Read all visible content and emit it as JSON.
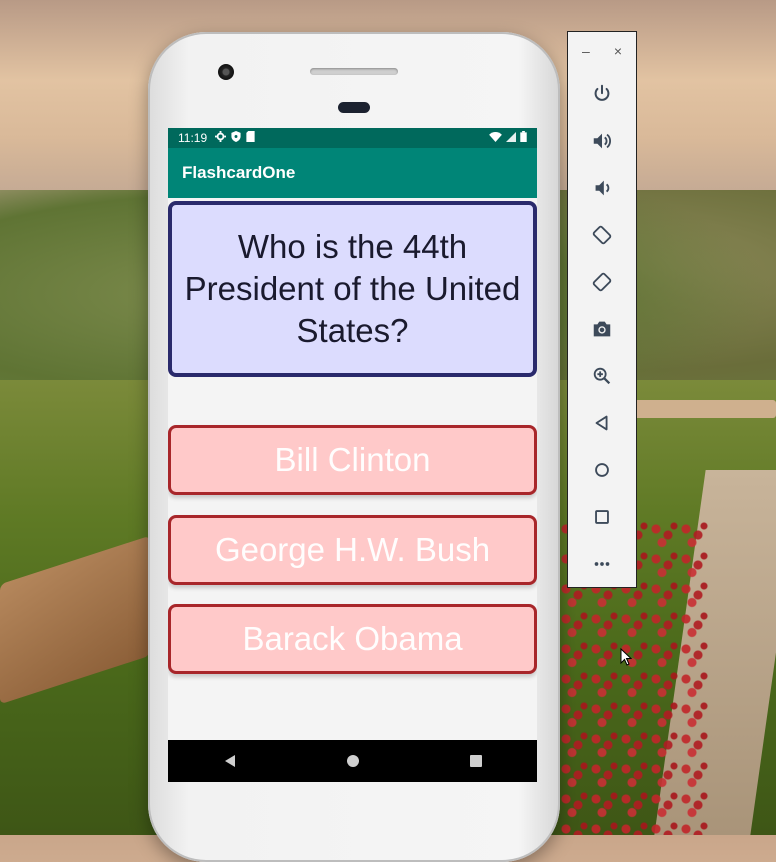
{
  "status_bar": {
    "time": "11:19"
  },
  "app": {
    "title": "FlashcardOne"
  },
  "question": {
    "text": "Who is the 44th President of the United States?"
  },
  "answers": [
    {
      "label": "Bill Clinton"
    },
    {
      "label": "George H.W. Bush"
    },
    {
      "label": "Barack Obama"
    }
  ],
  "emulator_toolbar": {
    "minimize_label": "–",
    "close_label": "×",
    "items": [
      {
        "icon": "power-icon"
      },
      {
        "icon": "volume-up-icon"
      },
      {
        "icon": "volume-down-icon"
      },
      {
        "icon": "rotate-left-icon"
      },
      {
        "icon": "rotate-right-icon"
      },
      {
        "icon": "camera-icon"
      },
      {
        "icon": "zoom-icon"
      },
      {
        "icon": "back-icon"
      },
      {
        "icon": "home-icon"
      },
      {
        "icon": "overview-icon"
      },
      {
        "icon": "more-icon"
      }
    ]
  },
  "colors": {
    "status_bar": "#00695c",
    "app_bar": "#008577",
    "question_bg": "#dcdcfe",
    "question_border": "#2a2a6c",
    "answer_bg": "#ffc9c9",
    "answer_border": "#a8262a"
  }
}
